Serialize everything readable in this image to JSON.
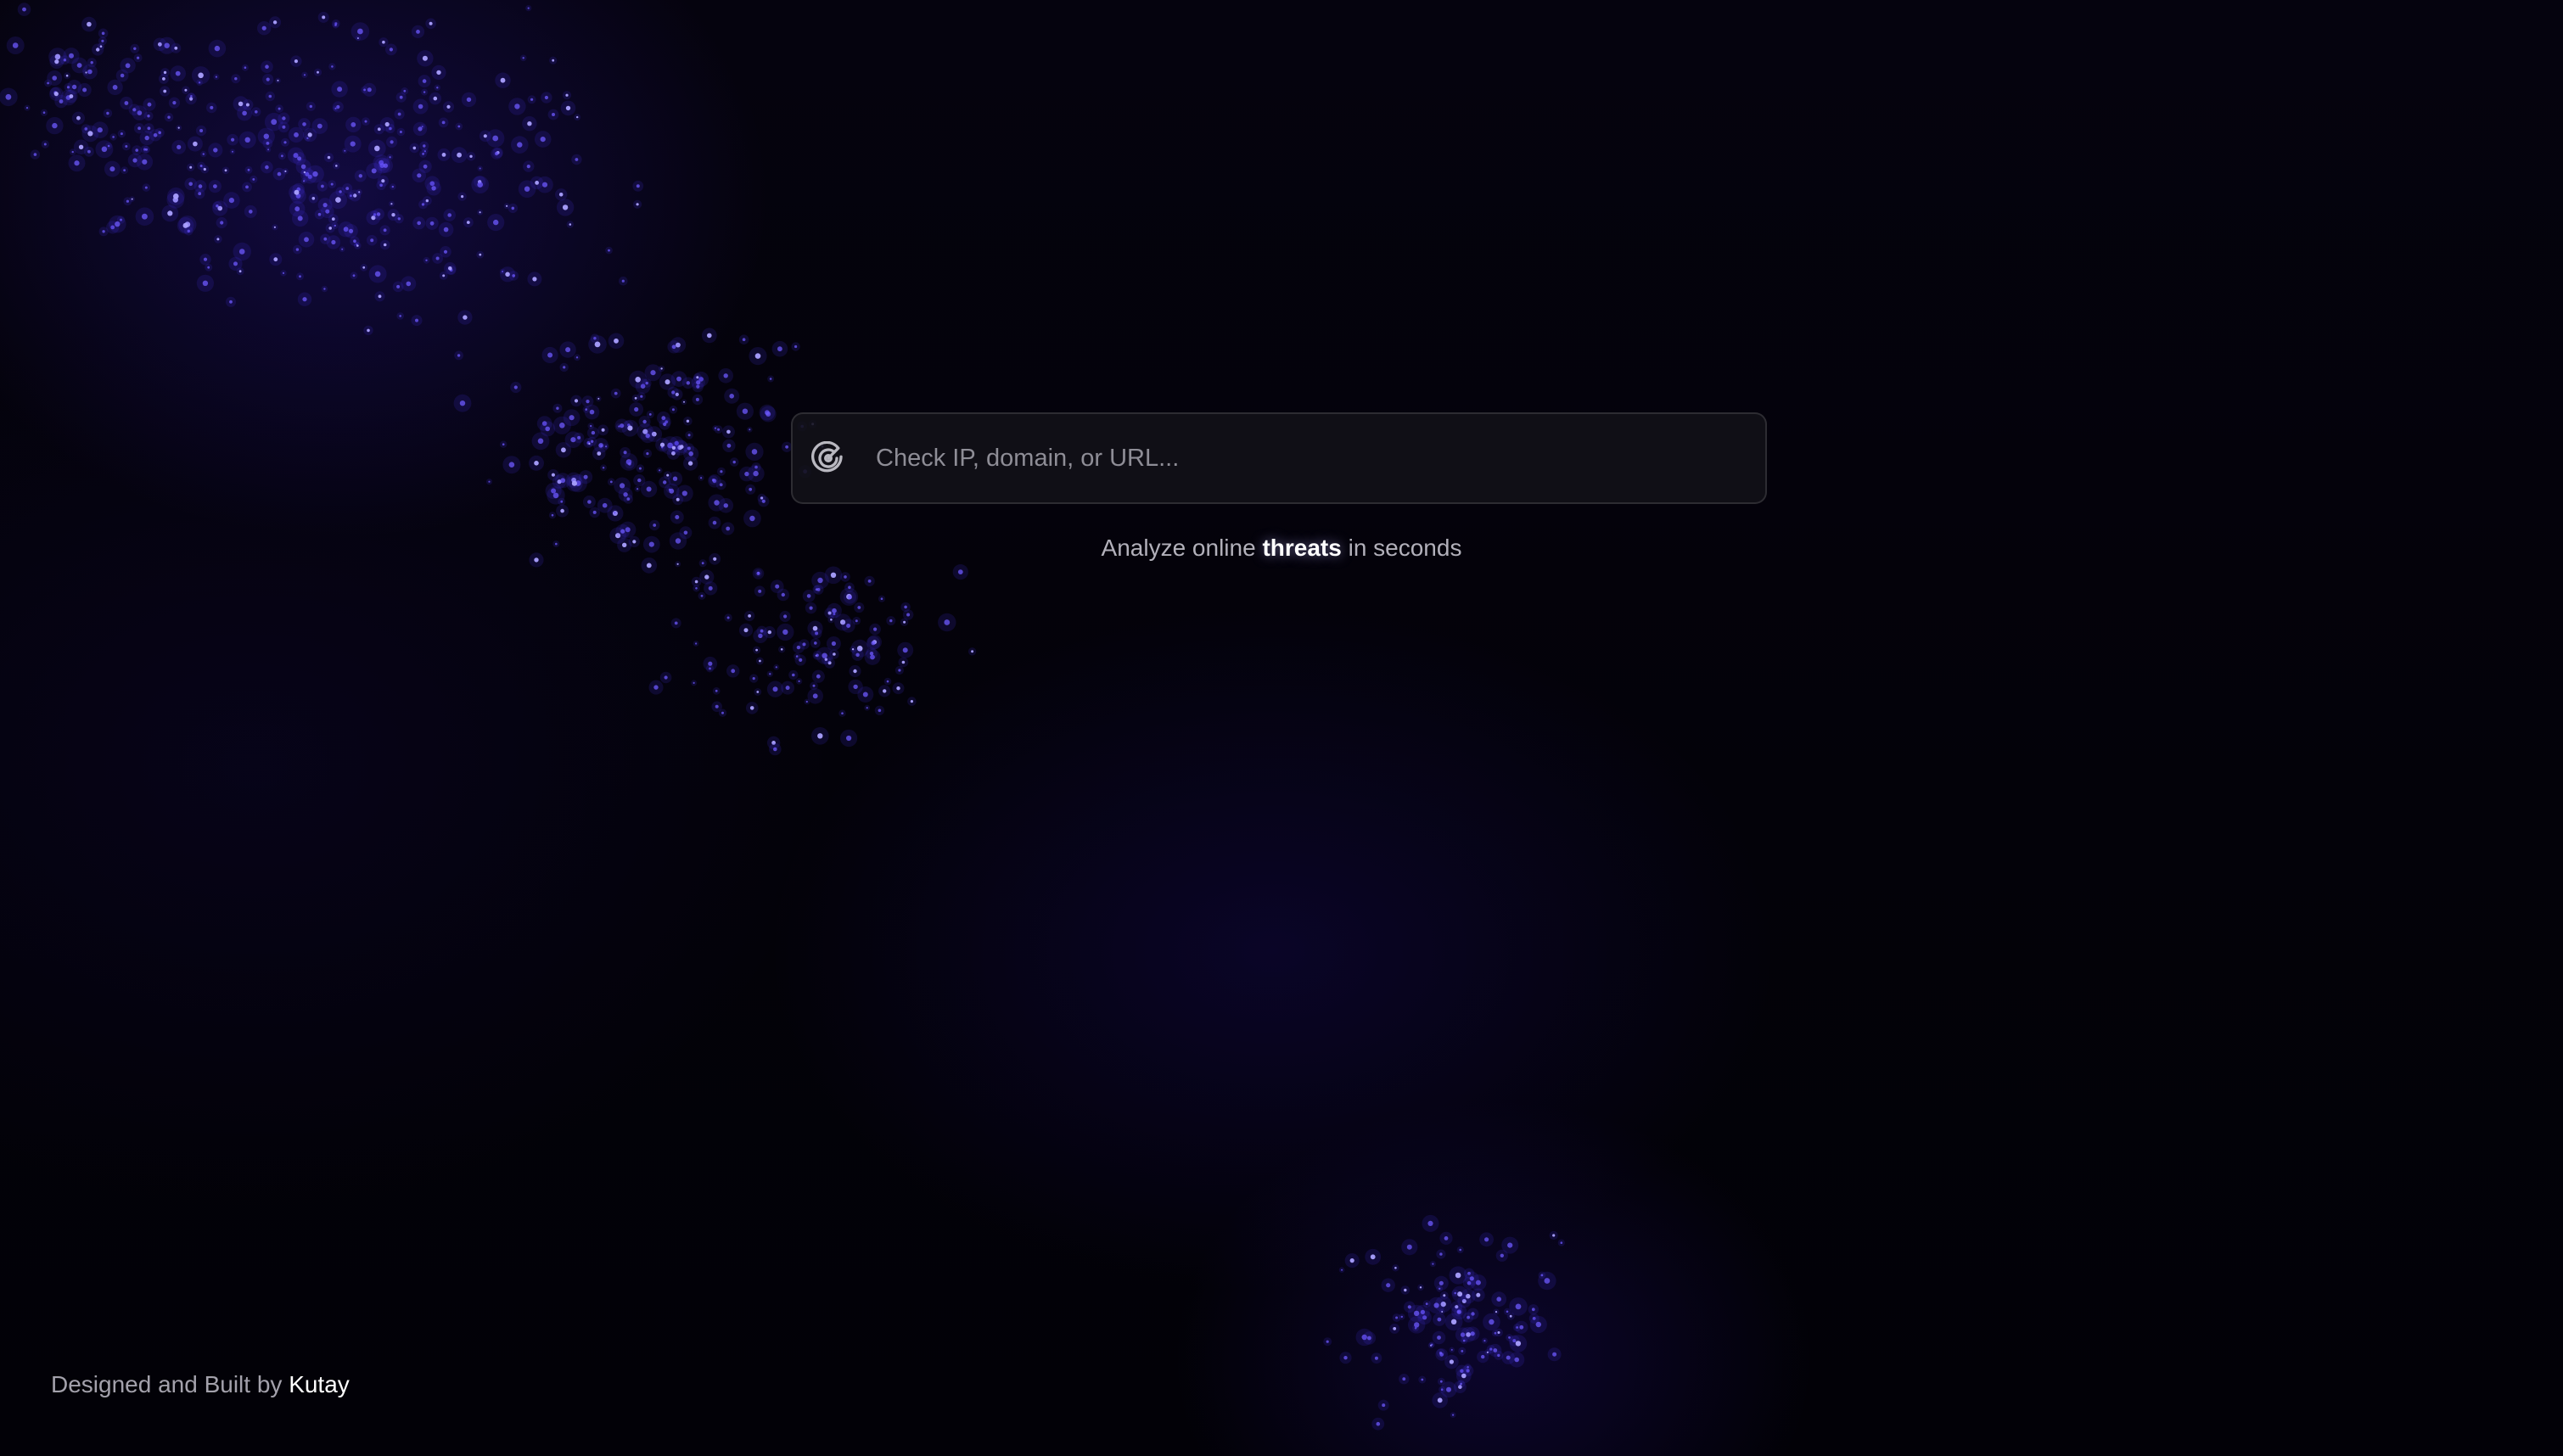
{
  "search": {
    "placeholder": "Check IP, domain, or URL...",
    "value": "",
    "icon": "radar-icon"
  },
  "tagline": {
    "before": "Analyze online ",
    "highlight": "threats",
    "after": " in seconds"
  },
  "footer": {
    "prefix": "Designed and Built by ",
    "author": "Kutay"
  },
  "colors": {
    "background": "#020106",
    "accent": "#5a46ff",
    "highlight_text": "#ffffff",
    "muted_text": "#b2b0ba"
  }
}
